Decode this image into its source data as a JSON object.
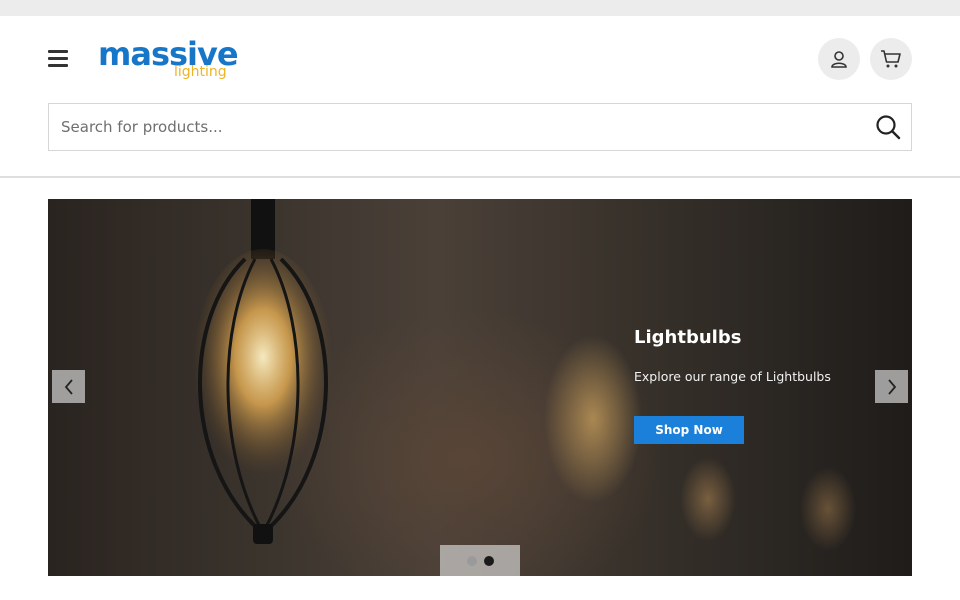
{
  "header": {
    "logo": {
      "main": "massive",
      "sub": "lighting"
    },
    "search": {
      "placeholder": "Search for products..."
    }
  },
  "hero": {
    "title": "Lightbulbs",
    "subtitle": "Explore our range of Lightbulbs",
    "cta": "Shop Now",
    "slide_count": 2,
    "active_slide": 2
  },
  "icons": {
    "menu": "hamburger-icon",
    "account": "user-icon",
    "cart": "cart-icon",
    "search": "search-icon",
    "prev": "chevron-left-icon",
    "next": "chevron-right-icon"
  },
  "colors": {
    "brand_blue": "#1876c9",
    "brand_yellow": "#f0b323",
    "cta_blue": "#1a80d9"
  }
}
